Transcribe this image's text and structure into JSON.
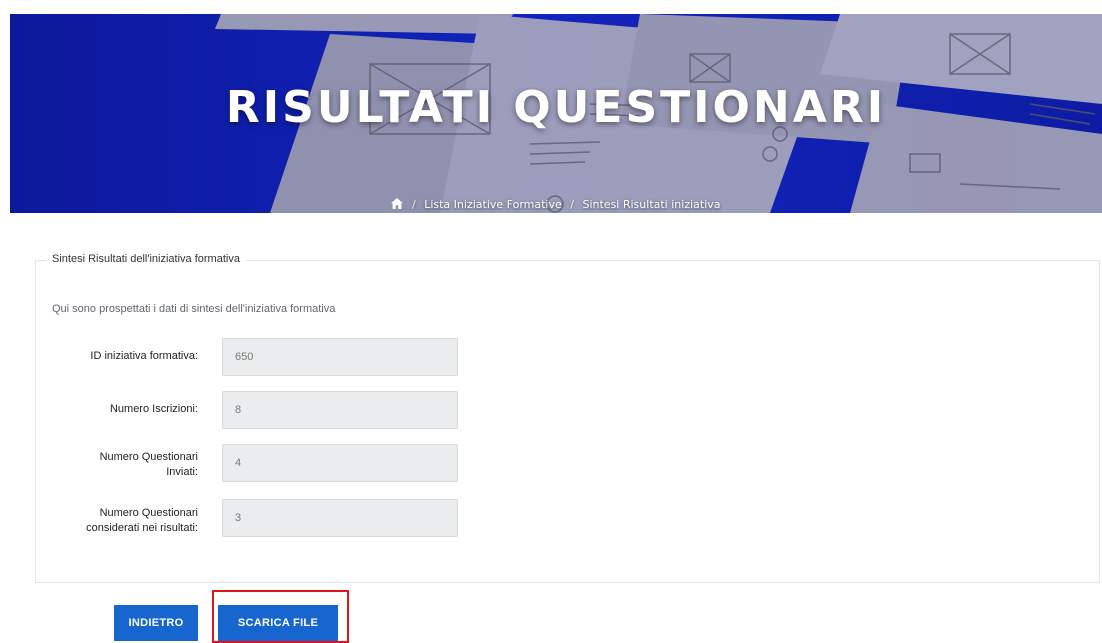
{
  "hero": {
    "title": "RISULTATI QUESTIONARI",
    "background_color": "#1424c4",
    "breadcrumb": [
      {
        "label": "Lista Iniziative Formative"
      },
      {
        "label": "Sintesi Risultati iniziativa"
      }
    ],
    "breadcrumb_separator": "/",
    "home_icon": "home-icon"
  },
  "panel": {
    "legend": "Sintesi Risultati dell'iniziativa formativa",
    "intro": "Qui sono prospettati i dati di sintesi dell'iniziativa formativa",
    "fields": [
      {
        "label": "ID iniziativa formativa:",
        "value": "650"
      },
      {
        "label_lines": [
          "Numero Iscrizioni:"
        ],
        "value": "8"
      },
      {
        "label_lines": [
          "Numero Questionari",
          "Inviati:"
        ],
        "value": "4"
      },
      {
        "label_lines": [
          "Numero Questionari",
          "considerati nei risultati:"
        ],
        "value": "3"
      }
    ]
  },
  "buttons": {
    "back_label": "INDIETRO",
    "download_label": "SCARICA FILE",
    "color": "#1766d0"
  },
  "annotation": {
    "highlight_color": "#e0141b"
  }
}
